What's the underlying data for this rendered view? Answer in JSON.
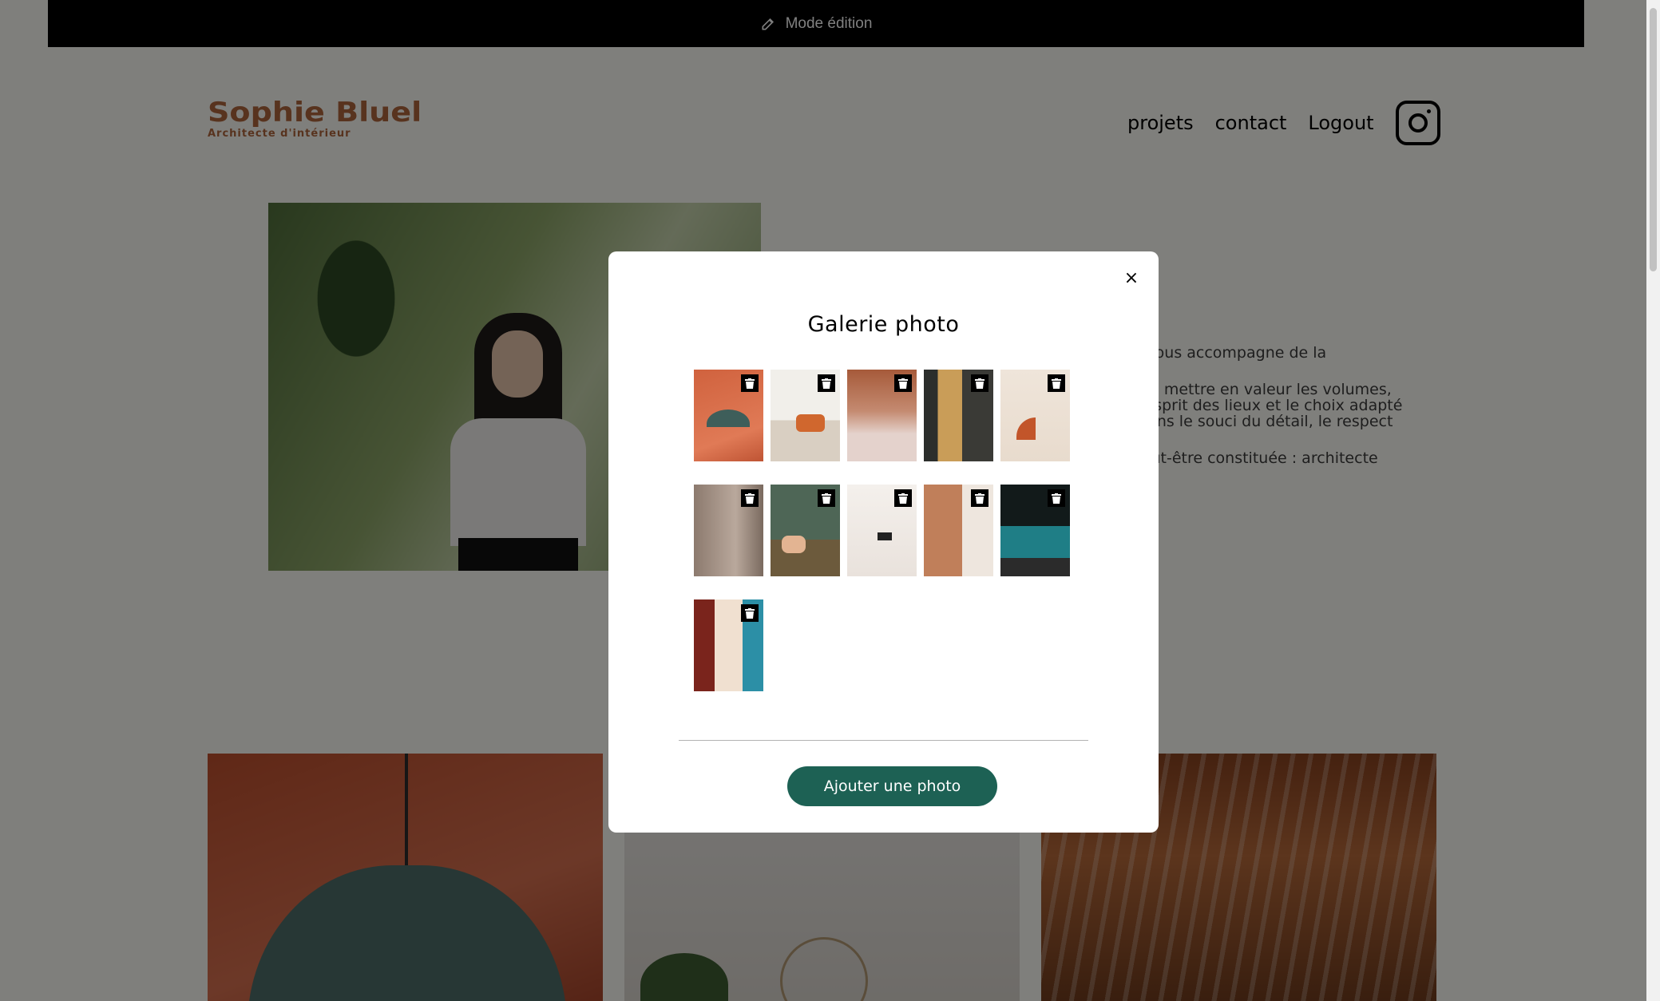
{
  "edit_bar": {
    "label": "Mode édition",
    "icon": "edit-icon"
  },
  "logo": {
    "title": "Sophie Bluel",
    "subtitle": "Architecte d'intérieur"
  },
  "nav": {
    "items": [
      "projets",
      "contact",
      "Logout"
    ],
    "social_icon": "instagram-icon"
  },
  "about": {
    "visible_fragments": [
      ". Je vous accompagne de la",
      "çon à mettre en valeur les volumes,",
      "le l'esprit des lieux et le choix adapté",
      "ré dans le souci du détail, le respect",
      "e peut-être constituée : architecte"
    ]
  },
  "modal": {
    "title": "Galerie photo",
    "close_label": "×",
    "photos": [
      {
        "name": "pendant-lamp-photo"
      },
      {
        "name": "living-room-photo"
      },
      {
        "name": "restaurant-photo"
      },
      {
        "name": "hotel-lobby-photo"
      },
      {
        "name": "arch-decor-photo"
      },
      {
        "name": "kitchen-photo"
      },
      {
        "name": "green-lounge-photo"
      },
      {
        "name": "white-room-photo"
      },
      {
        "name": "hallway-photo"
      },
      {
        "name": "bar-photo"
      },
      {
        "name": "dining-hall-photo"
      }
    ],
    "delete_icon": "trash-icon",
    "add_button": "Ajouter une photo"
  },
  "colors": {
    "accent": "#1D6154",
    "brand": "#B1663C",
    "overlay": "rgba(0,0,0,0.5)"
  }
}
